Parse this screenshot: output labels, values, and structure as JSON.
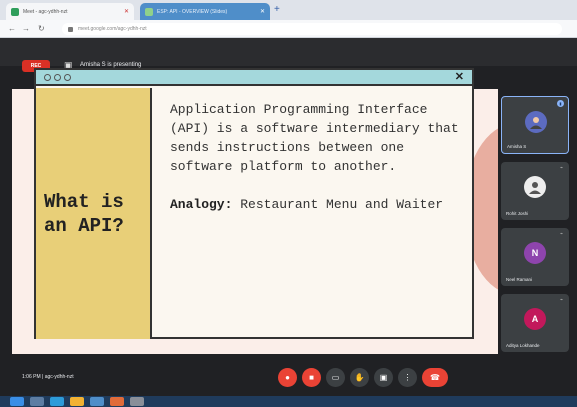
{
  "browser": {
    "tabs": [
      {
        "title": "Meet - agc-ydhh-nzt",
        "active": false
      },
      {
        "title": "ESP: API - OVERVIEW (Slides)",
        "active": true
      }
    ],
    "new_tab_symbol": "+",
    "nav": {
      "back": "←",
      "forward": "→",
      "reload": "↻"
    },
    "url": "meet.google.com/agc-ydhh-nzt"
  },
  "meet": {
    "rec_label": "REC",
    "presenter_label": "Amisha S is presenting",
    "time_and_code": "1:06 PM  |  agc-ydhh-nzt",
    "controls": [
      "mic",
      "camera",
      "captions",
      "raise-hand",
      "present",
      "more",
      "end-call"
    ],
    "participants": [
      {
        "name": "Amisha S",
        "avatar_letter": "",
        "avatar_color": "#5c6bc0",
        "active": true
      },
      {
        "name": "Rohit Joshi",
        "avatar_letter": "",
        "avatar_color": "#eeeeee",
        "active": false
      },
      {
        "name": "Neel Ramani",
        "avatar_letter": "N",
        "avatar_color": "#8e44ad",
        "active": false
      },
      {
        "name": "Aditya Lokhande",
        "avatar_letter": "A",
        "avatar_color": "#c2185b",
        "active": false
      }
    ]
  },
  "slide": {
    "heading": "What is an API?",
    "definition": "Application Programming Interface (API) is a software intermediary that sends instructions between one software platform to another.",
    "analogy_label": "Analogy:",
    "analogy_text": "Restaurant Menu and Waiter",
    "close_symbol": "✕"
  },
  "colors": {
    "slide_bg": "#fbeee9",
    "window_titlebar": "#a4d8dc",
    "window_left": "#e8cf78",
    "accent_circle": "#e8aea0",
    "meet_bg": "#202124",
    "end_call": "#ea4335"
  }
}
